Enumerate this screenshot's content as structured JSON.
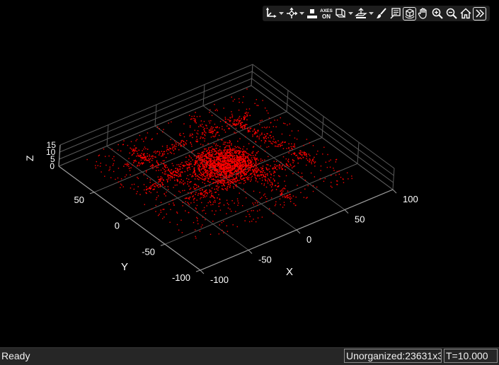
{
  "toolbar": {
    "icons": [
      "axes-transform-icon",
      "rotate-icon",
      "color-fill-icon",
      "axes-on-off-icon",
      "view-plane-icon",
      "ground-plane-icon",
      "paint-brush-icon",
      "data-tip-icon",
      "rotate-3d-icon",
      "pan-hand-icon",
      "zoom-in-icon",
      "zoom-out-icon",
      "home-icon",
      "more-icon"
    ],
    "axes_toggle_label": [
      "AXES",
      "ON"
    ]
  },
  "plot": {
    "x_label": "X",
    "y_label": "Y",
    "z_label": "Z",
    "x_ticks": [
      "-100",
      "-50",
      "0",
      "50",
      "100"
    ],
    "y_ticks": [
      "-100",
      "-50",
      "0",
      "50"
    ],
    "z_ticks": [
      "0",
      "5",
      "10",
      "15"
    ],
    "point_color": "#ff0000",
    "background": "#000000",
    "grid_color": "#5a5a5a"
  },
  "status": {
    "text": "Ready",
    "point_count": "Unorganized:23631x3",
    "time": "T=10.000"
  }
}
